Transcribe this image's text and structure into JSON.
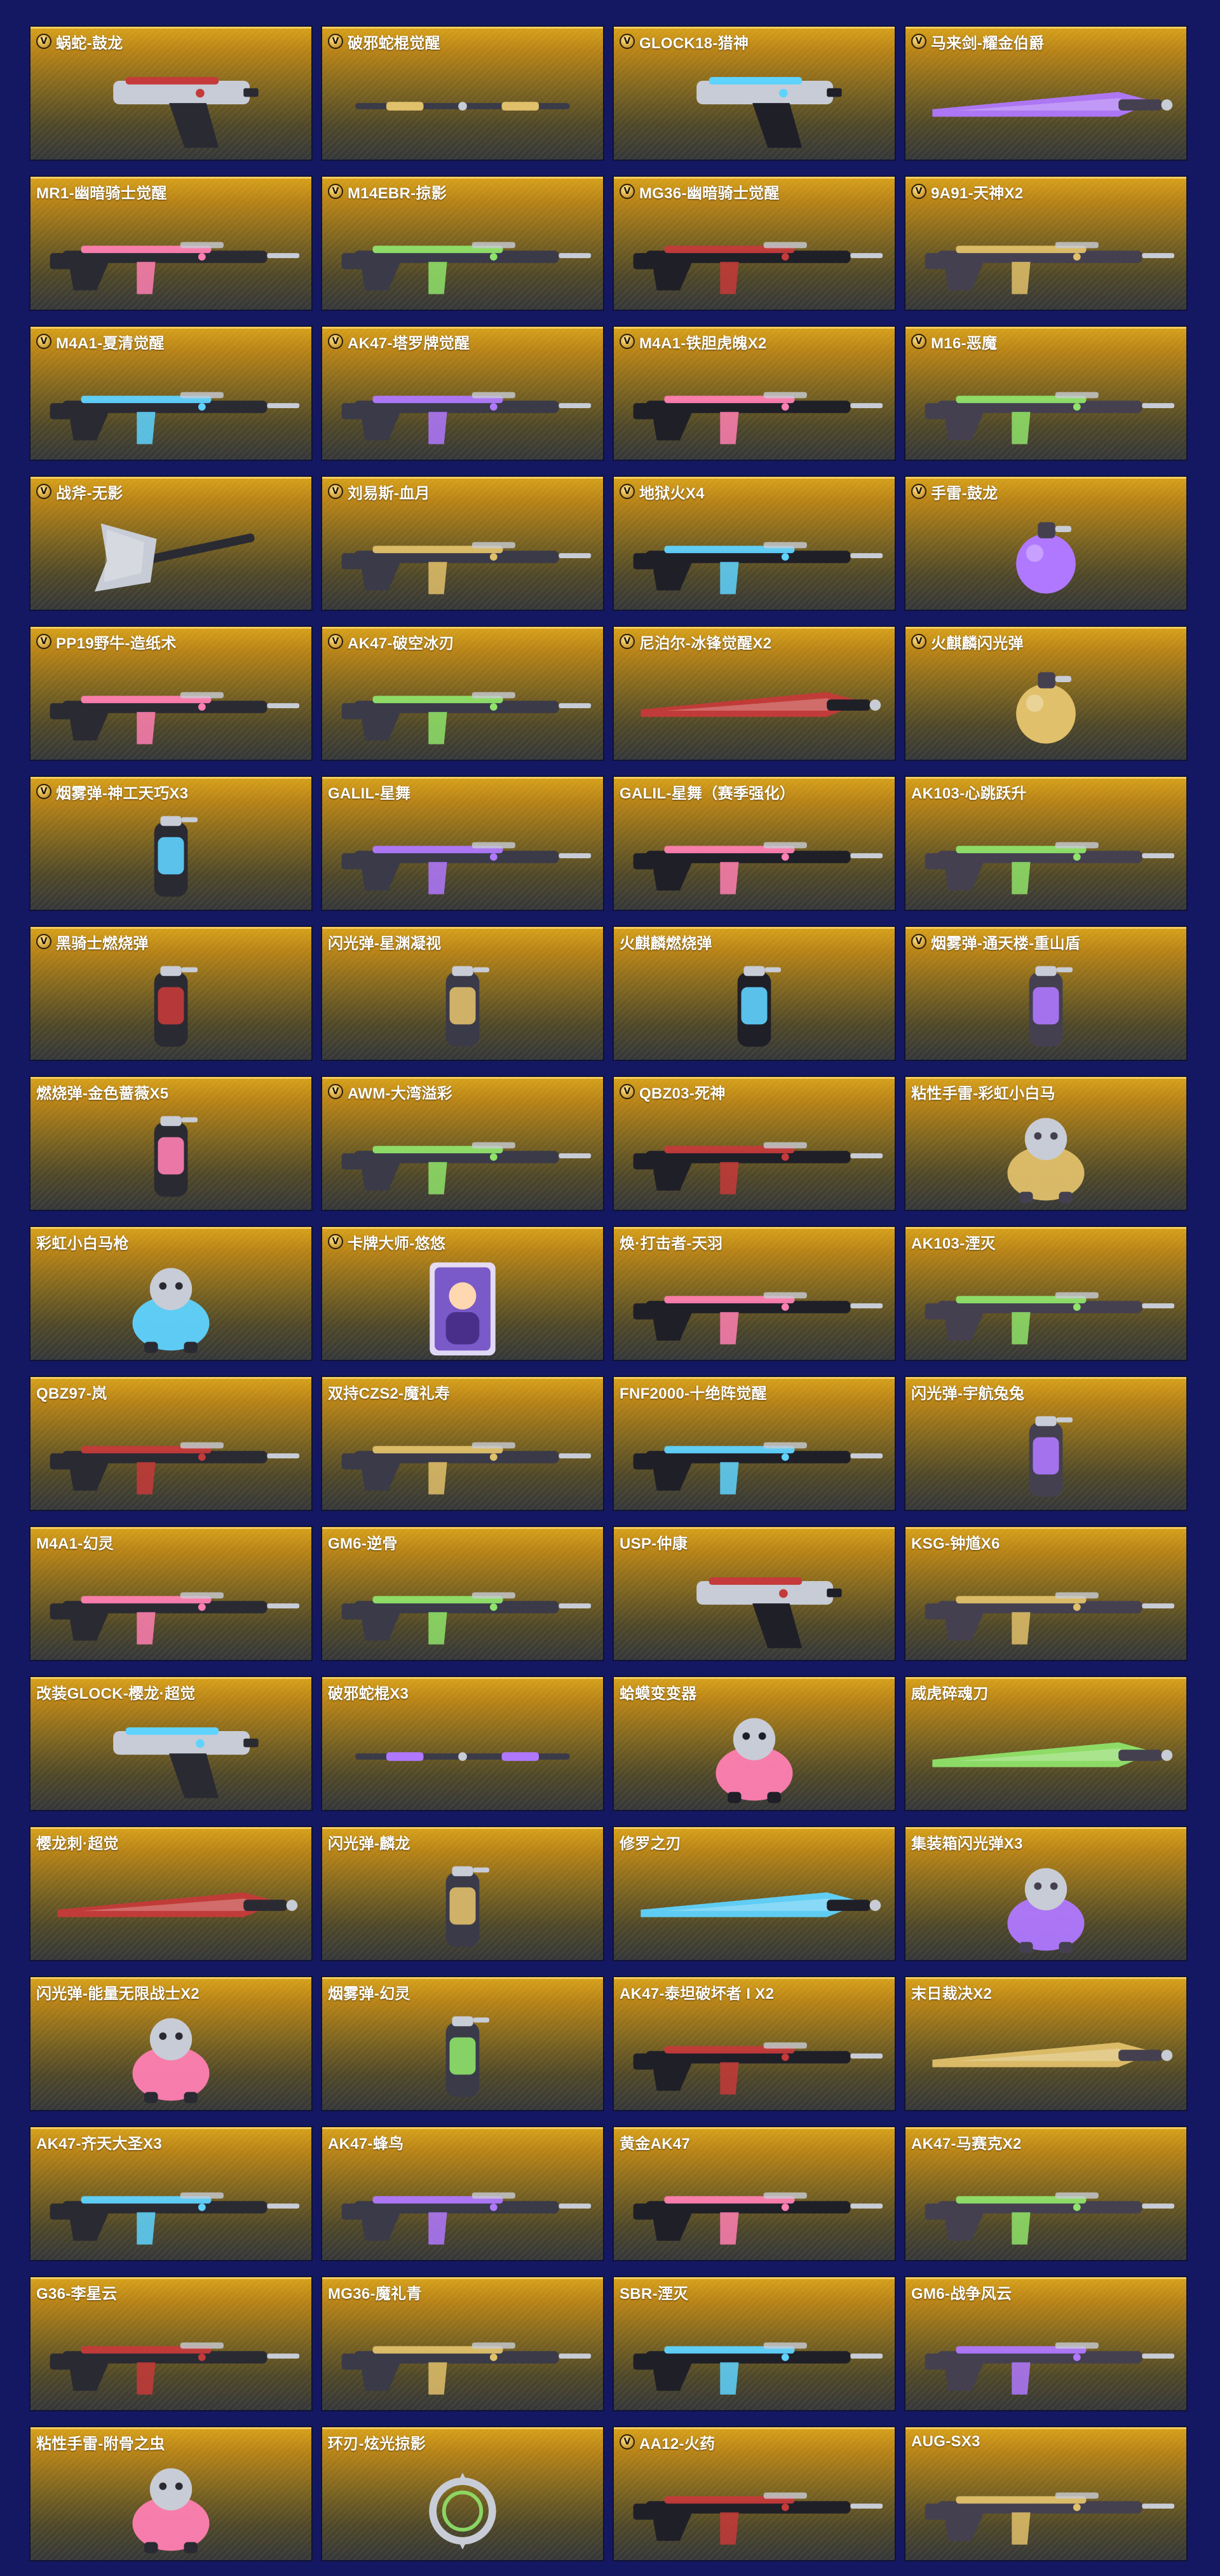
{
  "badge_letter": "V",
  "items": [
    {
      "name": "蜗蛇-鼓龙",
      "vip": true,
      "art": "pistol-icon"
    },
    {
      "name": "破邪蛇棍觉醒",
      "vip": true,
      "art": "staff-icon"
    },
    {
      "name": "GLOCK18-猎神",
      "vip": true,
      "art": "pistol-icon"
    },
    {
      "name": "马来剑-耀金伯爵",
      "vip": true,
      "art": "blade-icon"
    },
    {
      "name": "MR1-幽暗骑士觉醒",
      "vip": false,
      "art": "rifle-icon"
    },
    {
      "name": "M14EBR-掠影",
      "vip": true,
      "art": "rifle-icon"
    },
    {
      "name": "MG36-幽暗骑士觉醒",
      "vip": true,
      "art": "rifle-icon"
    },
    {
      "name": "9A91-天神X2",
      "vip": true,
      "art": "rifle-icon"
    },
    {
      "name": "M4A1-夏清觉醒",
      "vip": true,
      "art": "rifle-icon"
    },
    {
      "name": "AK47-塔罗牌觉醒",
      "vip": true,
      "art": "rifle-icon"
    },
    {
      "name": "M4A1-铁胆虎魄X2",
      "vip": true,
      "art": "rifle-icon"
    },
    {
      "name": "M16-恶魔",
      "vip": true,
      "art": "rifle-icon"
    },
    {
      "name": "战斧-无影",
      "vip": true,
      "art": "axe-icon"
    },
    {
      "name": "刘易斯-血月",
      "vip": true,
      "art": "rifle-icon"
    },
    {
      "name": "地狱火X4",
      "vip": true,
      "art": "rifle-icon"
    },
    {
      "name": "手雷-鼓龙",
      "vip": true,
      "art": "grenade-icon"
    },
    {
      "name": "PP19野牛-造纸术",
      "vip": true,
      "art": "rifle-icon"
    },
    {
      "name": "AK47-破空冰刃",
      "vip": true,
      "art": "rifle-icon"
    },
    {
      "name": "尼泊尔-冰锋觉醒X2",
      "vip": true,
      "art": "blade-icon"
    },
    {
      "name": "火麒麟闪光弹",
      "vip": true,
      "art": "grenade-icon"
    },
    {
      "name": "烟雾弹-神工天巧X3",
      "vip": true,
      "art": "canister-icon"
    },
    {
      "name": "GALIL-星舞",
      "vip": false,
      "art": "rifle-icon"
    },
    {
      "name": "GALIL-星舞（赛季强化）",
      "vip": false,
      "art": "rifle-icon"
    },
    {
      "name": "AK103-心跳跃升",
      "vip": false,
      "art": "rifle-icon"
    },
    {
      "name": "黑骑士燃烧弹",
      "vip": true,
      "art": "canister-icon"
    },
    {
      "name": "闪光弹-星渊凝视",
      "vip": false,
      "art": "canister-icon"
    },
    {
      "name": "火麒麟燃烧弹",
      "vip": false,
      "art": "canister-icon"
    },
    {
      "name": "烟雾弹-通天楼-重山盾",
      "vip": true,
      "art": "canister-icon"
    },
    {
      "name": "燃烧弹-金色蔷薇X5",
      "vip": false,
      "art": "canister-icon"
    },
    {
      "name": "AWM-大湾溢彩",
      "vip": true,
      "art": "rifle-icon"
    },
    {
      "name": "QBZ03-死神",
      "vip": true,
      "art": "rifle-icon"
    },
    {
      "name": "粘性手雷-彩虹小白马",
      "vip": false,
      "art": "figure-icon"
    },
    {
      "name": "彩虹小白马枪",
      "vip": false,
      "art": "figure-icon"
    },
    {
      "name": "卡牌大师-悠悠",
      "vip": true,
      "art": "card-icon"
    },
    {
      "name": "焕·打击者-天羽",
      "vip": false,
      "art": "rifle-icon"
    },
    {
      "name": "AK103-湮灭",
      "vip": false,
      "art": "rifle-icon"
    },
    {
      "name": "QBZ97-岚",
      "vip": false,
      "art": "rifle-icon"
    },
    {
      "name": "双持CZS2-魔礼寿",
      "vip": false,
      "art": "rifle-icon"
    },
    {
      "name": "FNF2000-十绝阵觉醒",
      "vip": false,
      "art": "rifle-icon"
    },
    {
      "name": "闪光弹-宇航兔兔",
      "vip": false,
      "art": "canister-icon"
    },
    {
      "name": "M4A1-幻灵",
      "vip": false,
      "art": "rifle-icon"
    },
    {
      "name": "GM6-逆骨",
      "vip": false,
      "art": "rifle-icon"
    },
    {
      "name": "USP-仲康",
      "vip": false,
      "art": "pistol-icon"
    },
    {
      "name": "KSG-钟馗X6",
      "vip": false,
      "art": "rifle-icon"
    },
    {
      "name": "改装GLOCK-樱龙·超觉",
      "vip": false,
      "art": "pistol-icon"
    },
    {
      "name": "破邪蛇棍X3",
      "vip": false,
      "art": "staff-icon"
    },
    {
      "name": "蛤蟆变变器",
      "vip": false,
      "art": "figure-icon"
    },
    {
      "name": "威虎碎魂刀",
      "vip": false,
      "art": "blade-icon"
    },
    {
      "name": "樱龙刺·超觉",
      "vip": false,
      "art": "blade-icon"
    },
    {
      "name": "闪光弹-麟龙",
      "vip": false,
      "art": "canister-icon"
    },
    {
      "name": "修罗之刃",
      "vip": false,
      "art": "blade-icon"
    },
    {
      "name": "集装箱闪光弹X3",
      "vip": false,
      "art": "figure-icon"
    },
    {
      "name": "闪光弹-能量无限战士X2",
      "vip": false,
      "art": "figure-icon"
    },
    {
      "name": "烟雾弹-幻灵",
      "vip": false,
      "art": "canister-icon"
    },
    {
      "name": "AK47-泰坦破坏者 I X2",
      "vip": false,
      "art": "rifle-icon"
    },
    {
      "name": "末日裁决X2",
      "vip": false,
      "art": "blade-icon"
    },
    {
      "name": "AK47-齐天大圣X3",
      "vip": false,
      "art": "rifle-icon"
    },
    {
      "name": "AK47-蜂鸟",
      "vip": false,
      "art": "rifle-icon"
    },
    {
      "name": "黄金AK47",
      "vip": false,
      "art": "rifle-icon"
    },
    {
      "name": "AK47-马赛克X2",
      "vip": false,
      "art": "rifle-icon"
    },
    {
      "name": "G36-李星云",
      "vip": false,
      "art": "rifle-icon"
    },
    {
      "name": "MG36-魔礼青",
      "vip": false,
      "art": "rifle-icon"
    },
    {
      "name": "SBR-湮灭",
      "vip": false,
      "art": "rifle-icon"
    },
    {
      "name": "GM6-战争风云",
      "vip": false,
      "art": "rifle-icon"
    },
    {
      "name": "粘性手雷-附骨之虫",
      "vip": false,
      "art": "figure-icon"
    },
    {
      "name": "环刃-炫光掠影",
      "vip": false,
      "art": "ring-blade-icon"
    },
    {
      "name": "AA12-火药",
      "vip": true,
      "art": "rifle-icon"
    },
    {
      "name": "AUG-SX3",
      "vip": false,
      "art": "rifle-icon"
    }
  ]
}
